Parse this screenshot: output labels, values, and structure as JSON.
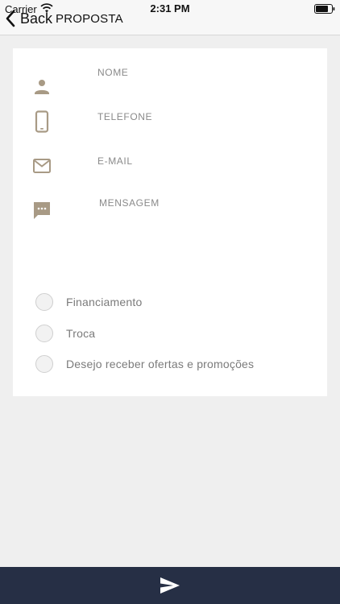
{
  "status_bar": {
    "carrier": "Carrier",
    "time": "2:31 PM"
  },
  "nav": {
    "back_label": "Back",
    "title": "PROPOSTA"
  },
  "form": {
    "name": {
      "placeholder": "NOME",
      "value": "",
      "icon": "person-icon"
    },
    "phone": {
      "placeholder": "TELEFONE",
      "value": "",
      "icon": "phone-icon"
    },
    "email": {
      "placeholder": "E-MAIL",
      "value": "",
      "icon": "mail-icon"
    },
    "message": {
      "placeholder": "MENSAGEM",
      "value": "",
      "icon": "chat-icon"
    }
  },
  "options": [
    {
      "label": "Financiamento",
      "selected": false
    },
    {
      "label": "Troca",
      "selected": false
    },
    {
      "label": "Desejo receber ofertas e promoções",
      "selected": false
    }
  ],
  "colors": {
    "icon_tan": "#a89a85",
    "bottom_bar": "#262f45",
    "background": "#efefef"
  },
  "bottom_bar": {
    "send_icon": "send-icon"
  }
}
